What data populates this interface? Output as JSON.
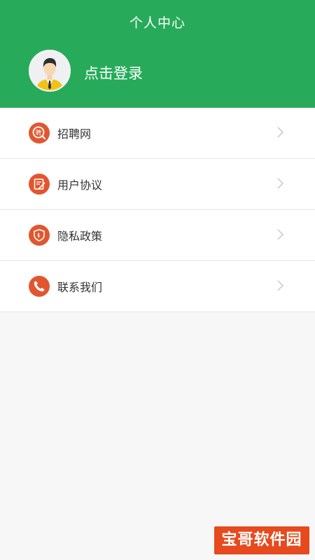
{
  "header": {
    "title": "个人中心",
    "login_text": "点击登录",
    "avatar_icon": "user-avatar-icon",
    "background_color": "#27ab5a"
  },
  "menu": {
    "items": [
      {
        "label": "招聘网",
        "icon": "recruitment-icon"
      },
      {
        "label": "用户协议",
        "icon": "document-edit-icon"
      },
      {
        "label": "隐私政策",
        "icon": "shield-icon"
      },
      {
        "label": "联系我们",
        "icon": "phone-icon"
      }
    ],
    "icon_color": "#e2562f",
    "chevron_icon": "chevron-right-icon"
  },
  "watermark": {
    "text": "宝哥软件园",
    "color": "#e64a1e"
  }
}
